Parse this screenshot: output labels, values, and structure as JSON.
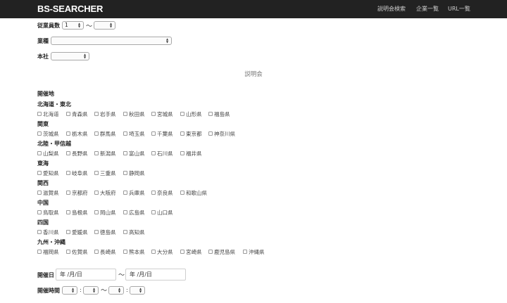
{
  "navbar": {
    "brand": "BS-SEARCHER",
    "links": [
      "説明会検索",
      "企業一覧",
      "URL一覧"
    ]
  },
  "filters": {
    "employees_label": "従業員数",
    "employees_min_value": "1",
    "employees_max_value": "",
    "range_sep": "〜",
    "industry_label": "業種",
    "industry_value": "",
    "hq_label": "本社",
    "hq_value": ""
  },
  "session": {
    "section_title": "説明会",
    "venue_label": "開催地",
    "regions": [
      {
        "name": "北海道・東北",
        "prefectures": [
          "北海道",
          "青森県",
          "岩手県",
          "秋田県",
          "宮城県",
          "山形県",
          "福島県"
        ]
      },
      {
        "name": "関東",
        "prefectures": [
          "茨城県",
          "栃木県",
          "群馬県",
          "埼玉県",
          "千葉県",
          "東京都",
          "神奈川県"
        ]
      },
      {
        "name": "北陸・甲信越",
        "prefectures": [
          "山梨県",
          "長野県",
          "新潟県",
          "富山県",
          "石川県",
          "福井県"
        ]
      },
      {
        "name": "東海",
        "prefectures": [
          "愛知県",
          "岐阜県",
          "三重県",
          "静岡県"
        ]
      },
      {
        "name": "関西",
        "prefectures": [
          "滋賀県",
          "京都府",
          "大阪府",
          "兵庫県",
          "奈良県",
          "和歌山県"
        ]
      },
      {
        "name": "中国",
        "prefectures": [
          "鳥取県",
          "島根県",
          "岡山県",
          "広島県",
          "山口県"
        ]
      },
      {
        "name": "四国",
        "prefectures": [
          "香川県",
          "愛媛県",
          "徳島県",
          "高知県"
        ]
      },
      {
        "name": "九州・沖縄",
        "prefectures": [
          "福岡県",
          "佐賀県",
          "長崎県",
          "熊本県",
          "大分県",
          "宮崎県",
          "鹿児島県",
          "沖縄県"
        ]
      }
    ],
    "date_label": "開催日",
    "date_placeholder": "年 /月/日",
    "time_label": "開催時間",
    "time_sep": ":"
  }
}
